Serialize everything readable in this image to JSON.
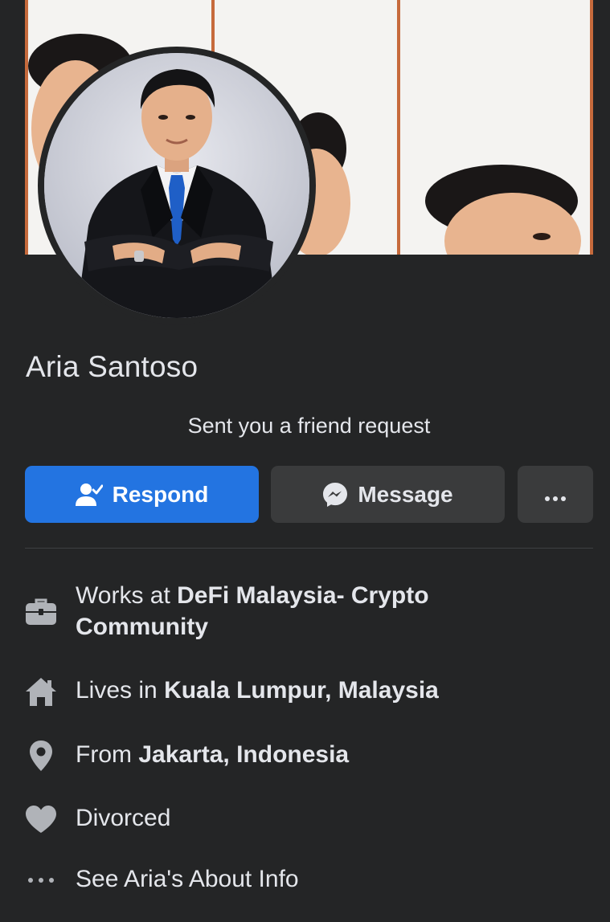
{
  "profile": {
    "name": "Aria Santoso",
    "status": "Sent you a friend request"
  },
  "actions": {
    "respond_label": "Respond",
    "message_label": "Message",
    "more_label": "•••"
  },
  "about": {
    "work": {
      "prefix": "Works at ",
      "value_line1": "DeFi Malaysia- Crypto",
      "value_line2": "Community"
    },
    "lives": {
      "prefix": "Lives in ",
      "value": "Kuala Lumpur, Malaysia"
    },
    "from": {
      "prefix": "From ",
      "value": "Jakarta, Indonesia"
    },
    "relationship": {
      "value": "Divorced"
    },
    "see_about": {
      "label": "See Aria's About Info"
    }
  },
  "icons": {
    "respond": "person-check-icon",
    "message": "messenger-icon",
    "more": "more-dots-icon",
    "work": "briefcase-icon",
    "lives": "home-icon",
    "from": "location-pin-icon",
    "relationship": "heart-icon",
    "see_about": "more-dots-icon"
  },
  "colors": {
    "background": "#242526",
    "primary_button": "#2374e1",
    "secondary_button": "#3a3b3c",
    "text": "#e4e6eb",
    "icon": "#b0b3b8"
  }
}
